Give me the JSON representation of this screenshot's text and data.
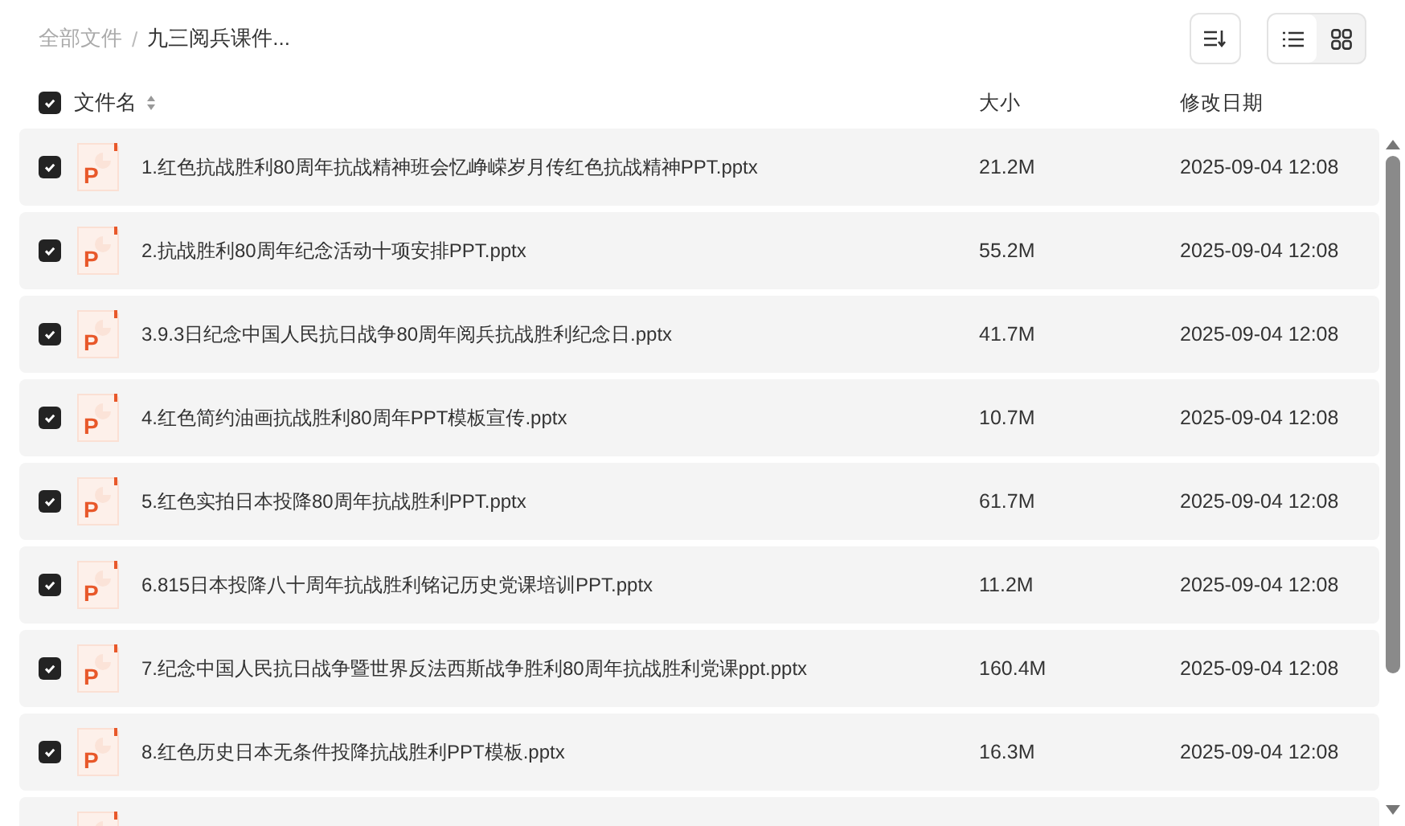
{
  "breadcrumb_separator": "/",
  "breadcrumb": [
    {
      "label": "全部文件",
      "current": false
    },
    {
      "label": "九三阅兵课件...",
      "current": true
    }
  ],
  "view_modes": [
    {
      "kind": "list",
      "selected": true
    },
    {
      "kind": "grid",
      "selected": false
    }
  ],
  "header": {
    "checked": true,
    "columns": [
      "文件名",
      "大小",
      "修改日期"
    ]
  },
  "files": [
    {
      "icon_label": "P",
      "name": "1.红色抗战胜利80周年抗战精神班会忆峥嵘岁月传红色抗战精神PPT.pptx",
      "size": "21.2M",
      "modified": "2025-09-04 12:08",
      "checked": true
    },
    {
      "icon_label": "P",
      "name": "2.抗战胜利80周年纪念活动十项安排PPT.pptx",
      "size": "55.2M",
      "modified": "2025-09-04 12:08",
      "checked": true
    },
    {
      "icon_label": "P",
      "name": "3.9.3日纪念中国人民抗日战争80周年阅兵抗战胜利纪念日.pptx",
      "size": "41.7M",
      "modified": "2025-09-04 12:08",
      "checked": true
    },
    {
      "icon_label": "P",
      "name": "4.红色简约油画抗战胜利80周年PPT模板宣传.pptx",
      "size": "10.7M",
      "modified": "2025-09-04 12:08",
      "checked": true
    },
    {
      "icon_label": "P",
      "name": "5.红色实拍日本投降80周年抗战胜利PPT.pptx",
      "size": "61.7M",
      "modified": "2025-09-04 12:08",
      "checked": true
    },
    {
      "icon_label": "P",
      "name": "6.815日本投降八十周年抗战胜利铭记历史党课培训PPT.pptx",
      "size": "11.2M",
      "modified": "2025-09-04 12:08",
      "checked": true
    },
    {
      "icon_label": "P",
      "name": "7.纪念中国人民抗日战争暨世界反法西斯战争胜利80周年抗战胜利党课ppt.pptx",
      "size": "160.4M",
      "modified": "2025-09-04 12:08",
      "checked": true
    },
    {
      "icon_label": "P",
      "name": "8.红色历史日本无条件投降抗战胜利PPT模板.pptx",
      "size": "16.3M",
      "modified": "2025-09-04 12:08",
      "checked": true
    }
  ]
}
